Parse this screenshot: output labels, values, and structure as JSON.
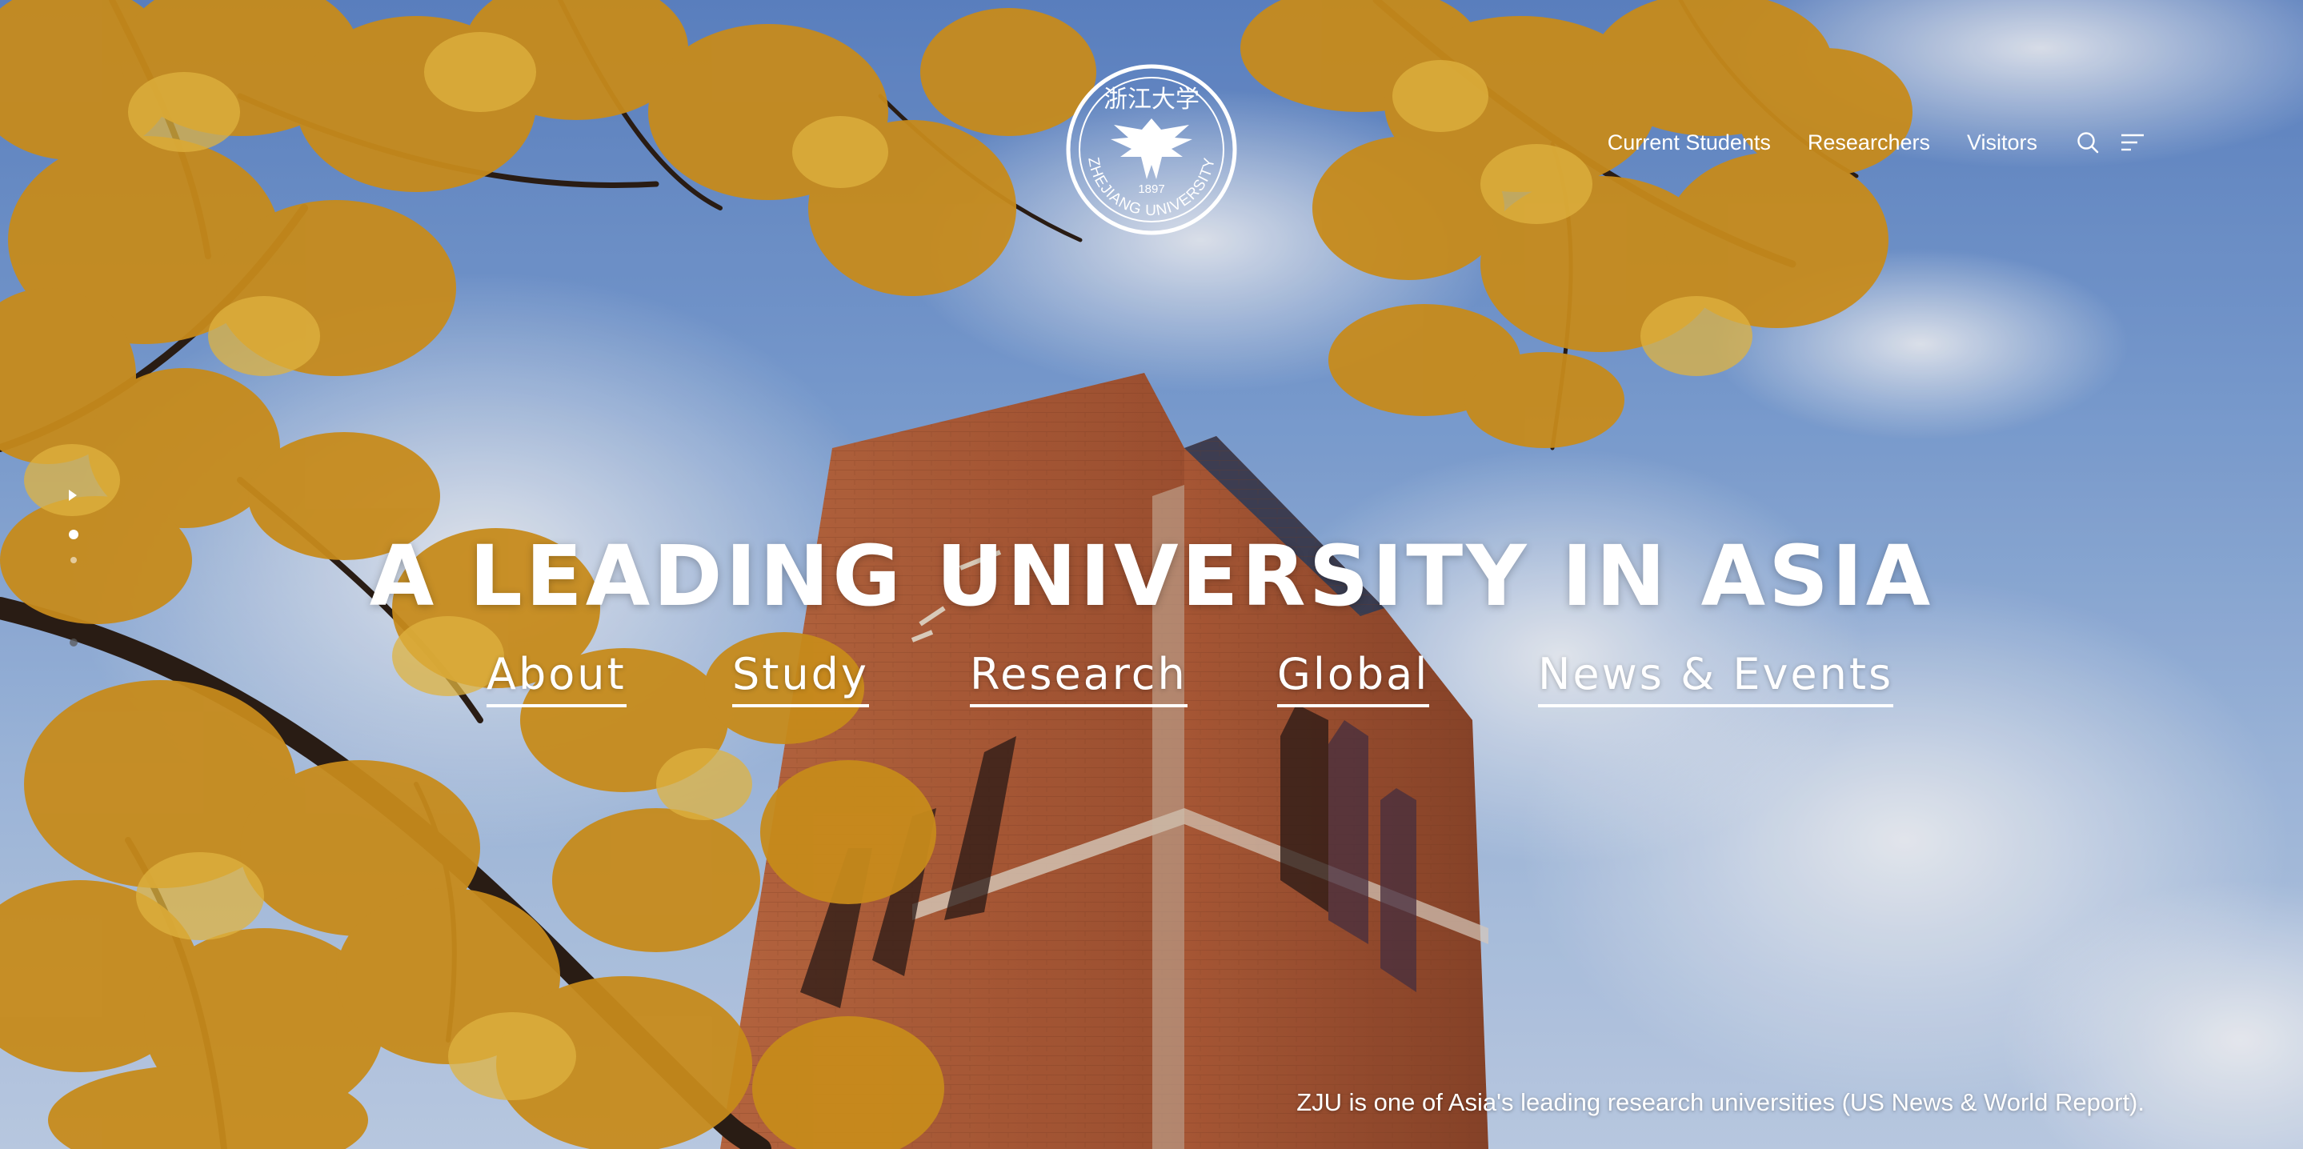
{
  "brand": {
    "logo_text": "ZHEJIANG UNIVERSITY",
    "logo_year": "1897",
    "logo_chinese": "浙江大学"
  },
  "top_nav": {
    "items": [
      {
        "label": "Current Students"
      },
      {
        "label": "Researchers"
      },
      {
        "label": "Visitors"
      }
    ],
    "search_icon": "search-icon",
    "menu_icon": "menu-icon"
  },
  "hero": {
    "title": "A LEADING UNIVERSITY IN ASIA"
  },
  "main_nav": {
    "items": [
      {
        "label": "About"
      },
      {
        "label": "Study"
      },
      {
        "label": "Research"
      },
      {
        "label": "Global"
      },
      {
        "label": "News & Events"
      }
    ]
  },
  "pager": {
    "count": 4,
    "active_index": 1
  },
  "tagline": "ZJU is one of Asia's leading research universities (US News & World Report).",
  "colors": {
    "sky": "#7ea3d8",
    "brick": "#b8623a",
    "foliage": "#d99a1c",
    "text": "#ffffff"
  }
}
